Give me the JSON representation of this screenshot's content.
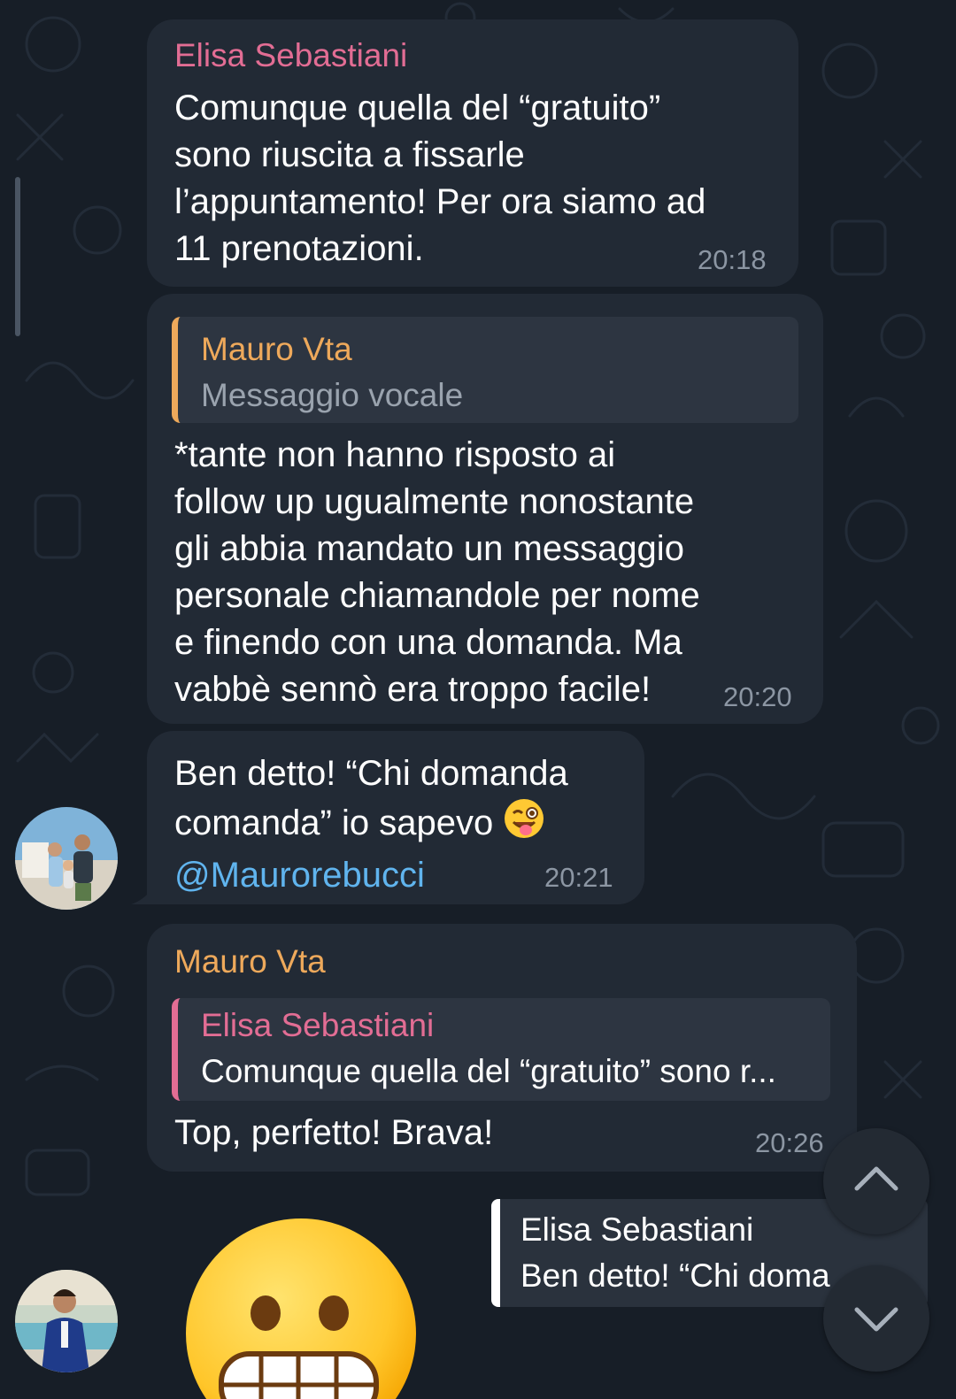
{
  "theme": {
    "background": "#171e27",
    "bubble": "#222a35",
    "quote_bg": "#2d3541",
    "accent_pink": "#e26d94",
    "accent_orange": "#eea95b",
    "link": "#60b4ee",
    "meta": "#8c96a3"
  },
  "messages": [
    {
      "sender": "Elisa Sebastiani",
      "text": "Comunque quella del “gratuito”\nsono riuscita a fissarle\nl’appuntamento! Per ora siamo ad\n11 prenotazioni.",
      "time": "20:18"
    },
    {
      "reply": {
        "sender": "Mauro Vta",
        "preview": "Messaggio vocale"
      },
      "text": "*tante non hanno risposto ai\nfollow up ugualmente nonostante\ngli abbia mandato un messaggio\npersonale chiamandole per nome\ne finendo con una domanda. Ma\nvabbè sennò era troppo facile!",
      "time": "20:20"
    },
    {
      "text": "Ben detto! “Chi domanda\ncomanda” io sapevo",
      "emoji": "winking-face-with-tongue",
      "mention": "@Maurorebucci",
      "time": "20:21"
    },
    {
      "sender": "Mauro Vta",
      "reply": {
        "sender": "Elisa Sebastiani",
        "preview": "Comunque quella del “gratuito” sono r..."
      },
      "text": "Top, perfetto! Brava!",
      "time": "20:26"
    }
  ],
  "reply_preview": {
    "sender": "Elisa Sebastiani",
    "text": "Ben detto! “Chi doma"
  },
  "sticker": {
    "emoji": "grimacing-face"
  },
  "icons": {
    "scroll_up": "chevron-up-icon",
    "scroll_down": "chevron-down-icon"
  }
}
